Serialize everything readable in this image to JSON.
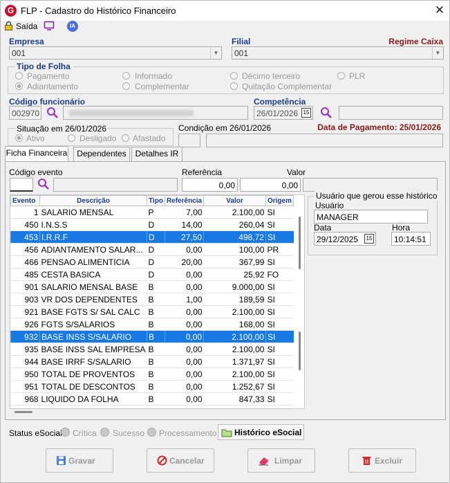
{
  "window": {
    "title": "FLP - Cadastro do Histórico Financeiro",
    "close": "✕"
  },
  "toolbar": {
    "saida": "Saída"
  },
  "empresa": {
    "label": "Empresa",
    "value": "001"
  },
  "filial": {
    "label": "Filial",
    "value": "001",
    "regime": "Regime Caixa"
  },
  "tipo_folha": {
    "label": "Tipo de Folha",
    "options": [
      "Pagamento",
      "Informado",
      "Décimo terceiro",
      "PLR",
      "Adiantamento",
      "Complementar",
      "Quitação Complementar"
    ],
    "selected": "Adiantamento"
  },
  "funcionario": {
    "label": "Código funcionário",
    "value": "002970"
  },
  "competencia": {
    "label": "Competência",
    "value": "26/01/2026"
  },
  "situacao": {
    "label": "Situação em 26/01/2026",
    "options": [
      "Ativo",
      "Desligado",
      "Afastado"
    ],
    "selected": "Ativo"
  },
  "condicao": {
    "label": "Condição em 26/01/2026"
  },
  "data_pagamento": "Data de Pagamento: 25/01/2026",
  "tabs": [
    "Ficha Financeira",
    "Dependentes",
    "Detalhes IR"
  ],
  "evento": {
    "label": "Código evento",
    "referencia_label": "Referência",
    "valor_label": "Valor",
    "referencia": "0,00",
    "valor": "0,00"
  },
  "table": {
    "headers": [
      "Evento",
      "Descrição",
      "Tipo",
      "Referência",
      "Valor",
      "Origem"
    ],
    "rows": [
      [
        "1",
        "SALARIO MENSAL",
        "P",
        "7,00",
        "2.100,00",
        "SI"
      ],
      [
        "450",
        "I.N.S.S",
        "D",
        "14,00",
        "260,04",
        "SI"
      ],
      [
        "453",
        "I.R.R.F",
        "D",
        "27,50",
        "498,72",
        "SI"
      ],
      [
        "456",
        "ADIANTAMENTO SALAR...",
        "D",
        "0,00",
        "100,00",
        "PR"
      ],
      [
        "466",
        "PENSAO ALIMENTICIA",
        "D",
        "20,00",
        "367,99",
        "SI"
      ],
      [
        "485",
        "CESTA BASICA",
        "D",
        "0,00",
        "25,92",
        "FO"
      ],
      [
        "901",
        "SALARIO MENSAL BASE",
        "B",
        "0,00",
        "9.000,00",
        "SI"
      ],
      [
        "903",
        "VR DOS DEPENDENTES",
        "B",
        "1,00",
        "189,59",
        "SI"
      ],
      [
        "921",
        "BASE FGTS S/ SAL CALC",
        "B",
        "0,00",
        "2.100,00",
        "SI"
      ],
      [
        "926",
        "FGTS S/SALARIOS",
        "B",
        "0,00",
        "168,00",
        "SI"
      ],
      [
        "932",
        "BASE INSS S/SALARIO",
        "B",
        "0,00",
        "2.100,00",
        "SI"
      ],
      [
        "935",
        "BASE INSS SAL EMPRESA",
        "B",
        "0,00",
        "2.100,00",
        "SI"
      ],
      [
        "944",
        "BASE IRRF S/SALARIO",
        "B",
        "0,00",
        "1.371,97",
        "SI"
      ],
      [
        "950",
        "TOTAL DE PROVENTOS",
        "B",
        "0,00",
        "2.100,00",
        "SI"
      ],
      [
        "951",
        "TOTAL DE DESCONTOS",
        "B",
        "0,00",
        "1.252,67",
        "SI"
      ],
      [
        "968",
        "LIQUIDO DA FOLHA",
        "B",
        "0,00",
        "847,33",
        "SI"
      ]
    ],
    "selected_rows": [
      "453",
      "932"
    ]
  },
  "usuario_box": {
    "title": "Usuário que gerou esse histórico",
    "usuario_label": "Usuário",
    "usuario": "MANAGER",
    "data_label": "Data",
    "data": "29/12/2025",
    "hora_label": "Hora",
    "hora": "10:14:51"
  },
  "esocial": {
    "label": "Status eSocial:",
    "options": [
      "Crítica",
      "Sucesso",
      "Processamento"
    ],
    "historico": "Histórico eSocial"
  },
  "buttons": {
    "gravar": "Gravar",
    "cancelar": "Cancelar",
    "limpar": "Limpar",
    "excluir": "Excluir"
  }
}
